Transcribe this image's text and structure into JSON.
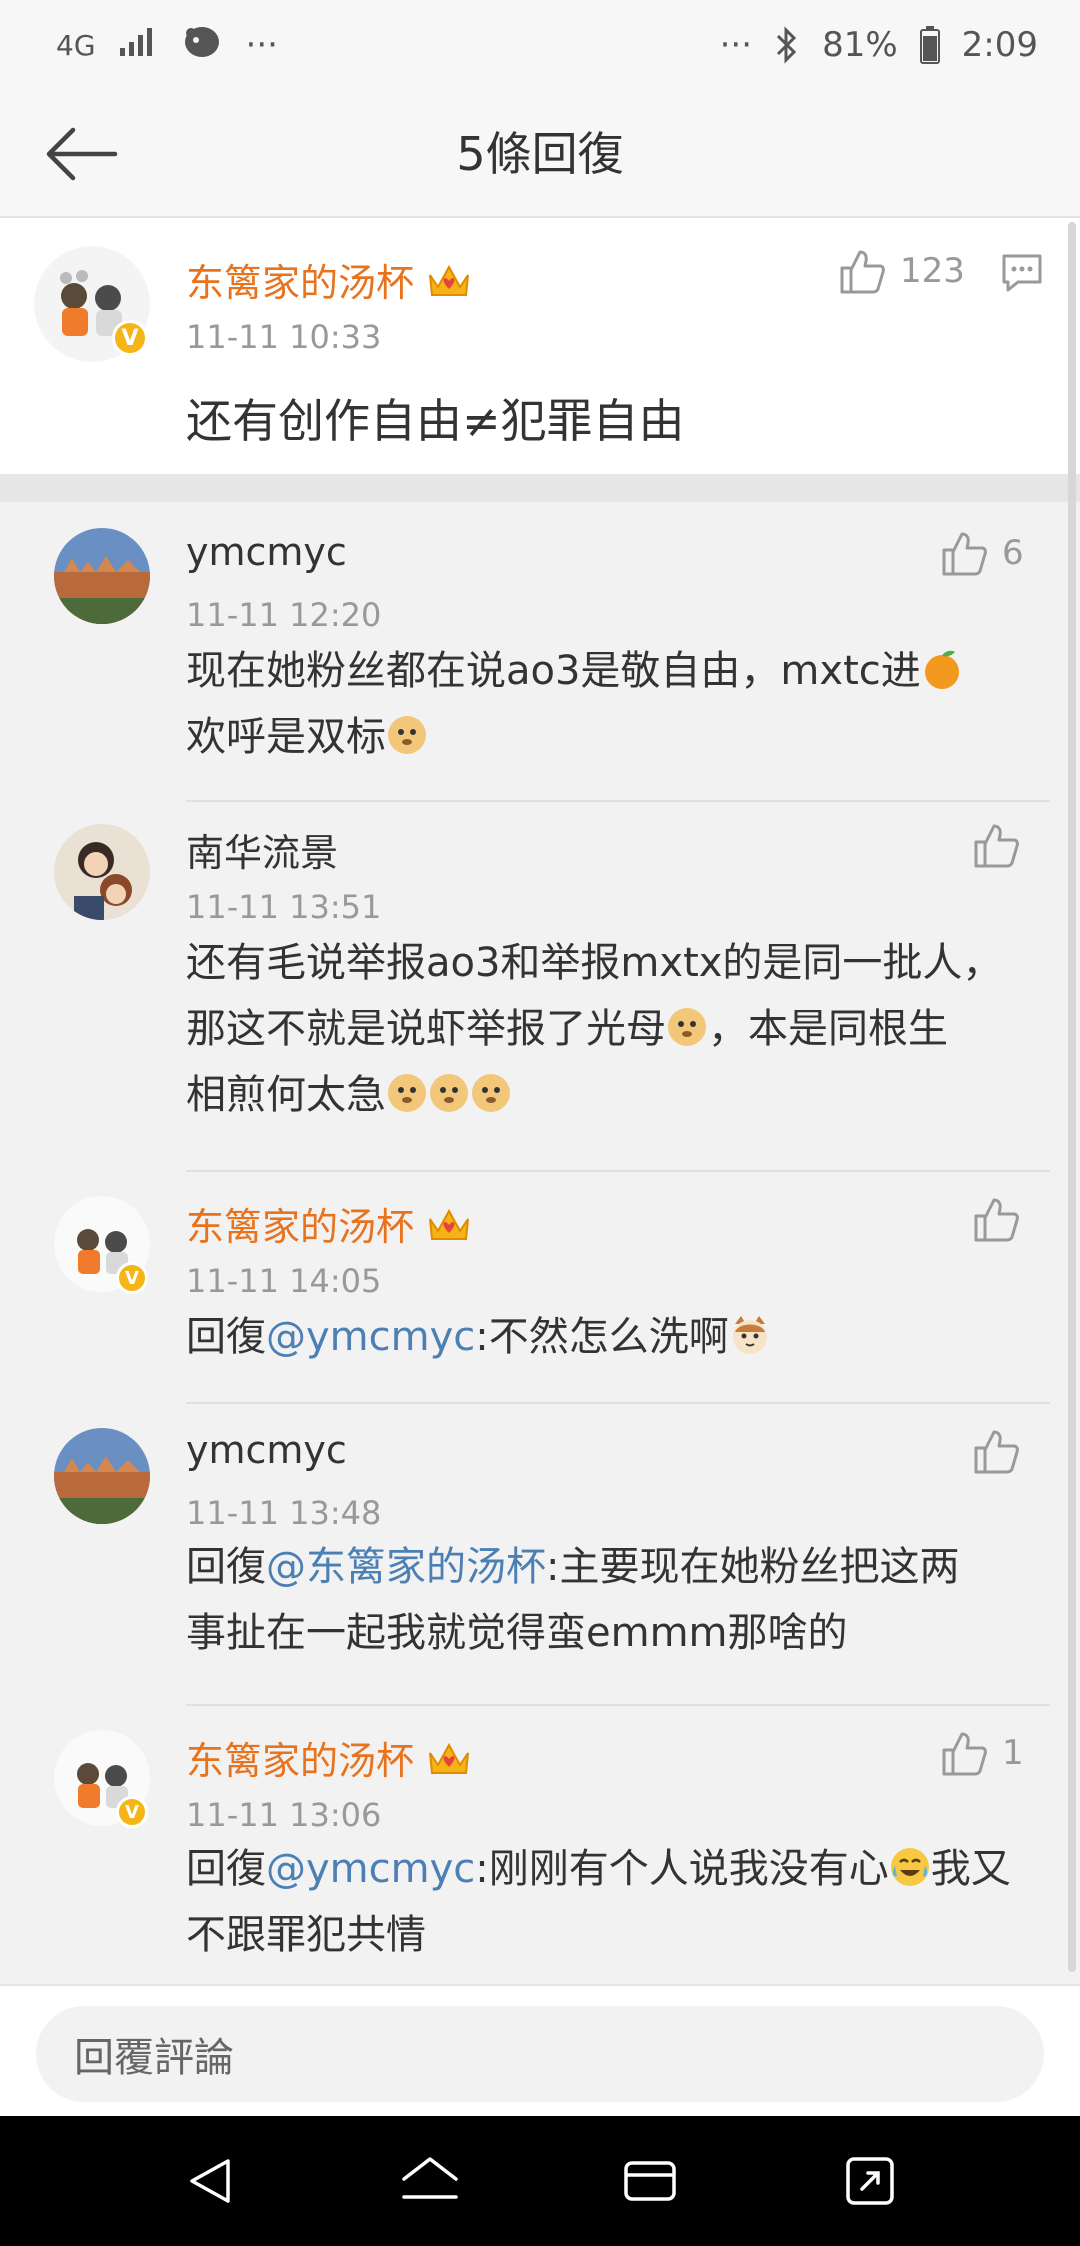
{
  "status_bar": {
    "network": "4G",
    "more_left": "···",
    "more_right": "···",
    "battery": "81%",
    "time": "2:09"
  },
  "header": {
    "title": "5條回復"
  },
  "main_comment": {
    "author": "东篱家的汤杯",
    "time": "11-11 10:33",
    "likes": "123",
    "text": "还有创作自由≠犯罪自由"
  },
  "replies": [
    {
      "author": "ymcmyc",
      "author_style": "plain",
      "time": "11-11 12:20",
      "likes": "6",
      "text_lines": [
        "现在她粉丝都在说ao3是敬自由，mxtc进",
        "欢呼是双标"
      ]
    },
    {
      "author": "南华流景",
      "author_style": "plain",
      "time": "11-11 13:51",
      "likes": "",
      "text_lines": [
        "还有毛说举报ao3和举报mxtx的是同一批人，",
        "那这不就是说虾举报了光母",
        "，本是同根生",
        "相煎何太急"
      ]
    },
    {
      "author": "东篱家的汤杯",
      "author_style": "orange",
      "time": "11-11 14:05",
      "likes": "",
      "prefix": "回復",
      "mention": "@ymcmyc",
      "text": ":不然怎么洗啊"
    },
    {
      "author": "ymcmyc",
      "author_style": "plain",
      "time": "11-11 13:48",
      "likes": "",
      "prefix": "回復",
      "mention": "@东篱家的汤杯",
      "text": ":主要现在她粉丝把这两",
      "text_line2": "事扯在一起我就觉得蛮emmm那啥的"
    },
    {
      "author": "东篱家的汤杯",
      "author_style": "orange",
      "time": "11-11 13:06",
      "likes": "1",
      "prefix": "回復",
      "mention": "@ymcmyc",
      "text": ":刚刚有个人说我没有心",
      "text_after_emoji": "我又",
      "text_line2": "不跟罪犯共情"
    }
  ],
  "reply_bar": {
    "placeholder": "回覆評論"
  },
  "colors": {
    "accent_orange": "#e8731f",
    "mention_blue": "#4c7fb3",
    "vip_gold": "#f6b516"
  }
}
